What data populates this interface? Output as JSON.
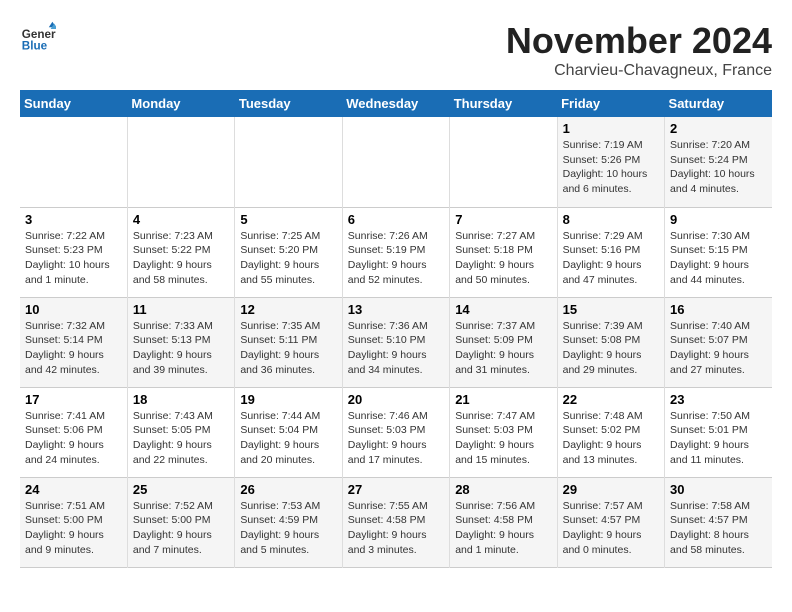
{
  "logo": {
    "text_general": "General",
    "text_blue": "Blue"
  },
  "header": {
    "month_year": "November 2024",
    "location": "Charvieu-Chavagneux, France"
  },
  "weekdays": [
    "Sunday",
    "Monday",
    "Tuesday",
    "Wednesday",
    "Thursday",
    "Friday",
    "Saturday"
  ],
  "weeks": [
    [
      {
        "day": "",
        "info": ""
      },
      {
        "day": "",
        "info": ""
      },
      {
        "day": "",
        "info": ""
      },
      {
        "day": "",
        "info": ""
      },
      {
        "day": "",
        "info": ""
      },
      {
        "day": "1",
        "info": "Sunrise: 7:19 AM\nSunset: 5:26 PM\nDaylight: 10 hours and 6 minutes."
      },
      {
        "day": "2",
        "info": "Sunrise: 7:20 AM\nSunset: 5:24 PM\nDaylight: 10 hours and 4 minutes."
      }
    ],
    [
      {
        "day": "3",
        "info": "Sunrise: 7:22 AM\nSunset: 5:23 PM\nDaylight: 10 hours and 1 minute."
      },
      {
        "day": "4",
        "info": "Sunrise: 7:23 AM\nSunset: 5:22 PM\nDaylight: 9 hours and 58 minutes."
      },
      {
        "day": "5",
        "info": "Sunrise: 7:25 AM\nSunset: 5:20 PM\nDaylight: 9 hours and 55 minutes."
      },
      {
        "day": "6",
        "info": "Sunrise: 7:26 AM\nSunset: 5:19 PM\nDaylight: 9 hours and 52 minutes."
      },
      {
        "day": "7",
        "info": "Sunrise: 7:27 AM\nSunset: 5:18 PM\nDaylight: 9 hours and 50 minutes."
      },
      {
        "day": "8",
        "info": "Sunrise: 7:29 AM\nSunset: 5:16 PM\nDaylight: 9 hours and 47 minutes."
      },
      {
        "day": "9",
        "info": "Sunrise: 7:30 AM\nSunset: 5:15 PM\nDaylight: 9 hours and 44 minutes."
      }
    ],
    [
      {
        "day": "10",
        "info": "Sunrise: 7:32 AM\nSunset: 5:14 PM\nDaylight: 9 hours and 42 minutes."
      },
      {
        "day": "11",
        "info": "Sunrise: 7:33 AM\nSunset: 5:13 PM\nDaylight: 9 hours and 39 minutes."
      },
      {
        "day": "12",
        "info": "Sunrise: 7:35 AM\nSunset: 5:11 PM\nDaylight: 9 hours and 36 minutes."
      },
      {
        "day": "13",
        "info": "Sunrise: 7:36 AM\nSunset: 5:10 PM\nDaylight: 9 hours and 34 minutes."
      },
      {
        "day": "14",
        "info": "Sunrise: 7:37 AM\nSunset: 5:09 PM\nDaylight: 9 hours and 31 minutes."
      },
      {
        "day": "15",
        "info": "Sunrise: 7:39 AM\nSunset: 5:08 PM\nDaylight: 9 hours and 29 minutes."
      },
      {
        "day": "16",
        "info": "Sunrise: 7:40 AM\nSunset: 5:07 PM\nDaylight: 9 hours and 27 minutes."
      }
    ],
    [
      {
        "day": "17",
        "info": "Sunrise: 7:41 AM\nSunset: 5:06 PM\nDaylight: 9 hours and 24 minutes."
      },
      {
        "day": "18",
        "info": "Sunrise: 7:43 AM\nSunset: 5:05 PM\nDaylight: 9 hours and 22 minutes."
      },
      {
        "day": "19",
        "info": "Sunrise: 7:44 AM\nSunset: 5:04 PM\nDaylight: 9 hours and 20 minutes."
      },
      {
        "day": "20",
        "info": "Sunrise: 7:46 AM\nSunset: 5:03 PM\nDaylight: 9 hours and 17 minutes."
      },
      {
        "day": "21",
        "info": "Sunrise: 7:47 AM\nSunset: 5:03 PM\nDaylight: 9 hours and 15 minutes."
      },
      {
        "day": "22",
        "info": "Sunrise: 7:48 AM\nSunset: 5:02 PM\nDaylight: 9 hours and 13 minutes."
      },
      {
        "day": "23",
        "info": "Sunrise: 7:50 AM\nSunset: 5:01 PM\nDaylight: 9 hours and 11 minutes."
      }
    ],
    [
      {
        "day": "24",
        "info": "Sunrise: 7:51 AM\nSunset: 5:00 PM\nDaylight: 9 hours and 9 minutes."
      },
      {
        "day": "25",
        "info": "Sunrise: 7:52 AM\nSunset: 5:00 PM\nDaylight: 9 hours and 7 minutes."
      },
      {
        "day": "26",
        "info": "Sunrise: 7:53 AM\nSunset: 4:59 PM\nDaylight: 9 hours and 5 minutes."
      },
      {
        "day": "27",
        "info": "Sunrise: 7:55 AM\nSunset: 4:58 PM\nDaylight: 9 hours and 3 minutes."
      },
      {
        "day": "28",
        "info": "Sunrise: 7:56 AM\nSunset: 4:58 PM\nDaylight: 9 hours and 1 minute."
      },
      {
        "day": "29",
        "info": "Sunrise: 7:57 AM\nSunset: 4:57 PM\nDaylight: 9 hours and 0 minutes."
      },
      {
        "day": "30",
        "info": "Sunrise: 7:58 AM\nSunset: 4:57 PM\nDaylight: 8 hours and 58 minutes."
      }
    ]
  ]
}
